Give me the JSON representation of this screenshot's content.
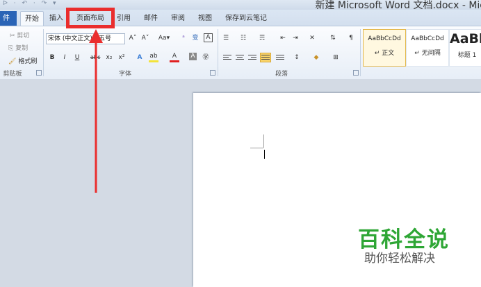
{
  "window": {
    "title": "新建 Microsoft Word 文档.docx - Mic",
    "quick_access": "ᐅ · ↶ · ↷ ▾"
  },
  "tabs": {
    "file": "件",
    "home": "开始",
    "insert": "插入",
    "page_layout": "页面布局",
    "references": "引用",
    "mailings": "邮件",
    "review": "审阅",
    "view": "视图",
    "cloud_notes": "保存到云笔记"
  },
  "clipboard": {
    "cut": "剪切",
    "copy": "复制",
    "format_painter": "格式刷",
    "label": "剪贴板"
  },
  "font": {
    "font_name": "宋体 (中文正文)",
    "font_size": "五号",
    "grow": "A˄",
    "shrink": "A˅",
    "change_case": "Aa▾",
    "clear": "ᵃ",
    "phonetic": "变",
    "border": "A",
    "bold": "B",
    "italic": "I",
    "underline": "U",
    "strike": "abc",
    "subscript": "x₂",
    "superscript": "x²",
    "effects": "A",
    "highlight": "ab",
    "color": "A",
    "shading": "A",
    "enclose": "㊫",
    "label": "字体"
  },
  "paragraph": {
    "label": "段落"
  },
  "styles": {
    "items": [
      {
        "sample": "AaBbCcDd",
        "name": "↵ 正文"
      },
      {
        "sample": "AaBbCcDd",
        "name": "↵ 无间隔"
      },
      {
        "sample": "AaBb",
        "name": "标题 1"
      }
    ]
  },
  "colors": {
    "accent_red": "#ea2d2d",
    "watermark_green": "#2ea635",
    "file_tab": "#2a64b6"
  },
  "watermark": {
    "main": "百科全说",
    "sub": "助你轻松解决"
  }
}
